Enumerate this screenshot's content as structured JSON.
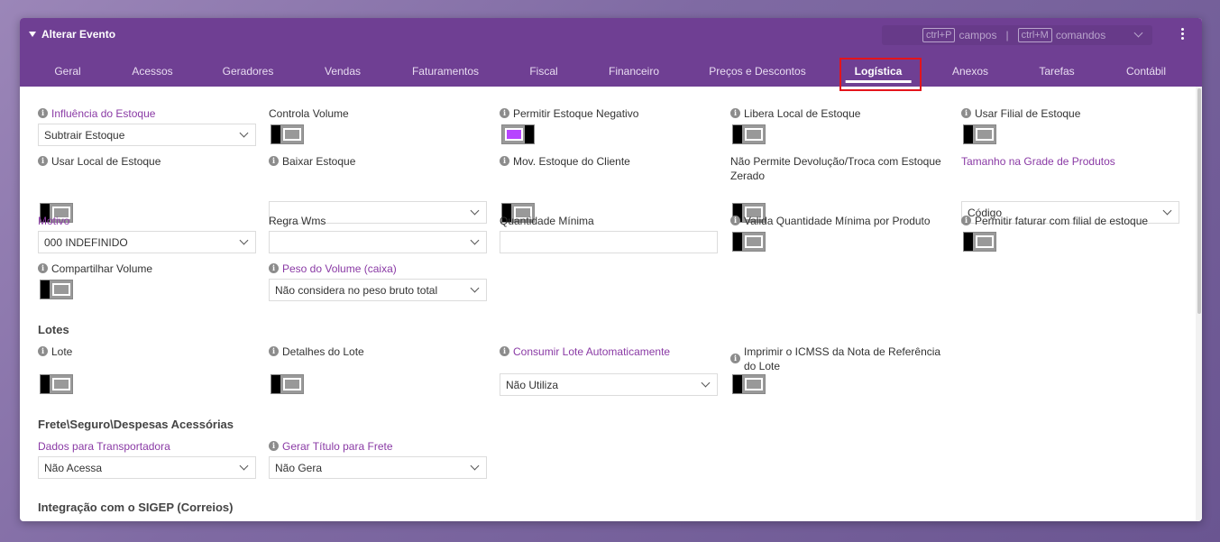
{
  "window": {
    "title": "Alterar Evento",
    "shortcut1_key": "ctrl+P",
    "shortcut1_label": "campos",
    "separator": "|",
    "shortcut2_key": "ctrl+M",
    "shortcut2_label": "comandos"
  },
  "tabs": [
    "Geral",
    "Acessos",
    "Geradores",
    "Vendas",
    "Faturamentos",
    "Fiscal",
    "Financeiro",
    "Preços e Descontos",
    "Logística",
    "Anexos",
    "Tarefas",
    "Contábil"
  ],
  "active_tab": "Logística",
  "colors": {
    "header": "#6f3f93",
    "toggle_on": "#b745ff",
    "highlight": "#e4141b",
    "label_purple": "#8a3aa5"
  },
  "fields": {
    "influencia_estoque": {
      "label": "Influência do Estoque",
      "value": "Subtrair Estoque"
    },
    "controla_volume": {
      "label": "Controla Volume",
      "on": false
    },
    "permitir_estoque_negativo": {
      "label": "Permitir Estoque Negativo",
      "on": true
    },
    "libera_local_estoque": {
      "label": "Libera Local de Estoque",
      "on": false
    },
    "usar_filial_estoque": {
      "label": "Usar Filial de Estoque",
      "on": false
    },
    "usar_local_estoque": {
      "label": "Usar Local de Estoque",
      "on": false
    },
    "baixar_estoque": {
      "label": "Baixar Estoque",
      "value": ""
    },
    "mov_estoque_cliente": {
      "label": "Mov. Estoque do Cliente",
      "on": false
    },
    "nao_permite_devolucao": {
      "label_line1": "Não Permite Devolução/Troca com Estoque",
      "label_line2": "Zerado",
      "on": false
    },
    "tamanho_grade": {
      "label": "Tamanho na Grade de Produtos",
      "value": "Código"
    },
    "motivo": {
      "label": "Motivo",
      "value": "000 INDEFINIDO"
    },
    "regra_wms": {
      "label": "Regra Wms",
      "value": ""
    },
    "quantidade_minima": {
      "label": "Quantidade Mínima",
      "value": ""
    },
    "valida_qtd_minima": {
      "label": "Valida Quantidade Mínima por Produto",
      "on": false
    },
    "permitir_faturar_filial": {
      "label": "Permitir faturar com filial de estoque",
      "on": false
    },
    "compartilhar_volume": {
      "label": "Compartilhar Volume",
      "on": false
    },
    "peso_volume": {
      "label": "Peso do Volume (caixa)",
      "value": "Não considera no peso bruto total"
    }
  },
  "sections": {
    "lotes": "Lotes",
    "frete": "Frete\\Seguro\\Despesas Acessórias",
    "sigep": "Integração com o SIGEP (Correios)"
  },
  "lotes": {
    "lote": {
      "label": "Lote",
      "on": false
    },
    "detalhes_lote": {
      "label": "Detalhes do Lote",
      "on": false
    },
    "consumir_lote": {
      "label": "Consumir Lote Automaticamente",
      "value": "Não Utiliza"
    },
    "imprimir_icmss": {
      "label_line1": "Imprimir o ICMSS da Nota de Referência",
      "label_line2": "do Lote",
      "on": false
    }
  },
  "frete": {
    "dados_transportadora": {
      "label": "Dados para Transportadora",
      "value": "Não Acessa"
    },
    "gerar_titulo_frete": {
      "label": "Gerar Título para Frete",
      "value": "Não Gera"
    }
  }
}
